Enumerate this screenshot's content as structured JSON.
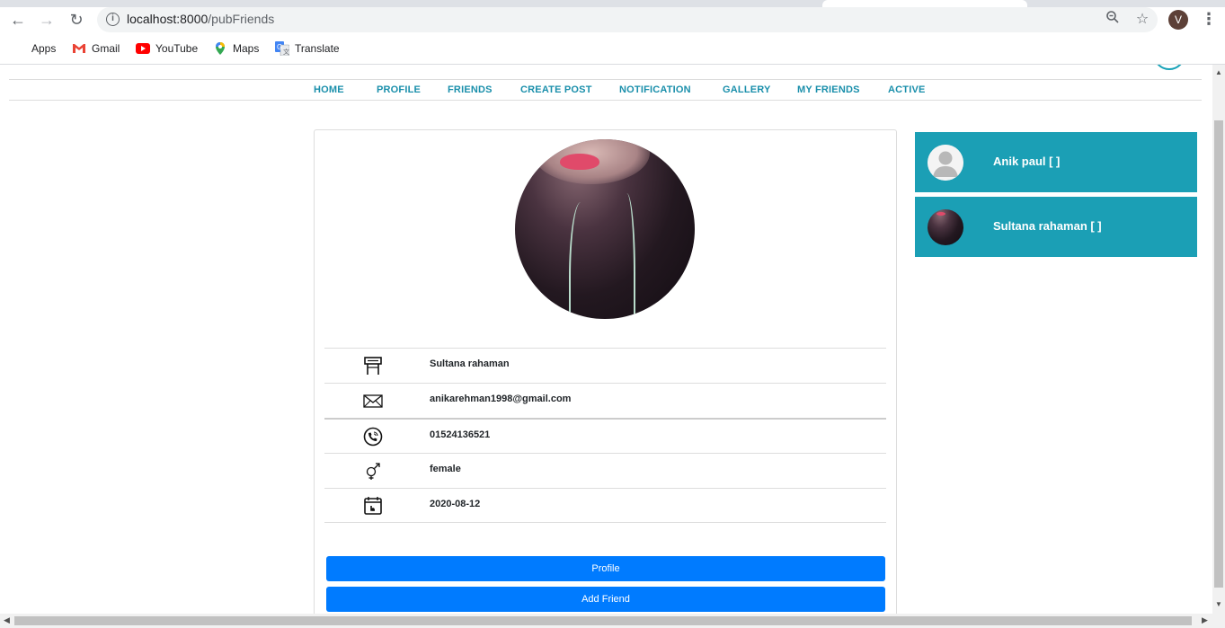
{
  "browser": {
    "url_host": "localhost:8000",
    "url_path": "/pubFriends",
    "profile_initial": "V",
    "bookmarks": [
      {
        "label": "Apps",
        "icon": "apps-grid-icon"
      },
      {
        "label": "Gmail",
        "icon": "gmail-icon"
      },
      {
        "label": "YouTube",
        "icon": "youtube-icon"
      },
      {
        "label": "Maps",
        "icon": "maps-icon"
      },
      {
        "label": "Translate",
        "icon": "translate-icon"
      }
    ]
  },
  "nav": {
    "items": [
      "HOME",
      "PROFILE",
      "FRIENDS",
      "CREATE POST",
      "NOTIFICATION",
      "GALLERY",
      "MY FRIENDS",
      "ACTIVE"
    ]
  },
  "profile": {
    "name": "Sultana rahaman",
    "email": "anikarehman1998@gmail.com",
    "phone": "01524136521",
    "gender": "female",
    "date": "2020-08-12",
    "profile_button": "Profile",
    "add_friend_button": "Add Friend"
  },
  "friends": [
    {
      "name": "Anik paul [ ]",
      "avatar": "default-user-avatar"
    },
    {
      "name": "Sultana rahaman [ ]",
      "avatar": "photo-avatar"
    }
  ],
  "colors": {
    "accent": "#1b9fb5",
    "nav_link": "#1a8fab",
    "button": "#007bff"
  }
}
